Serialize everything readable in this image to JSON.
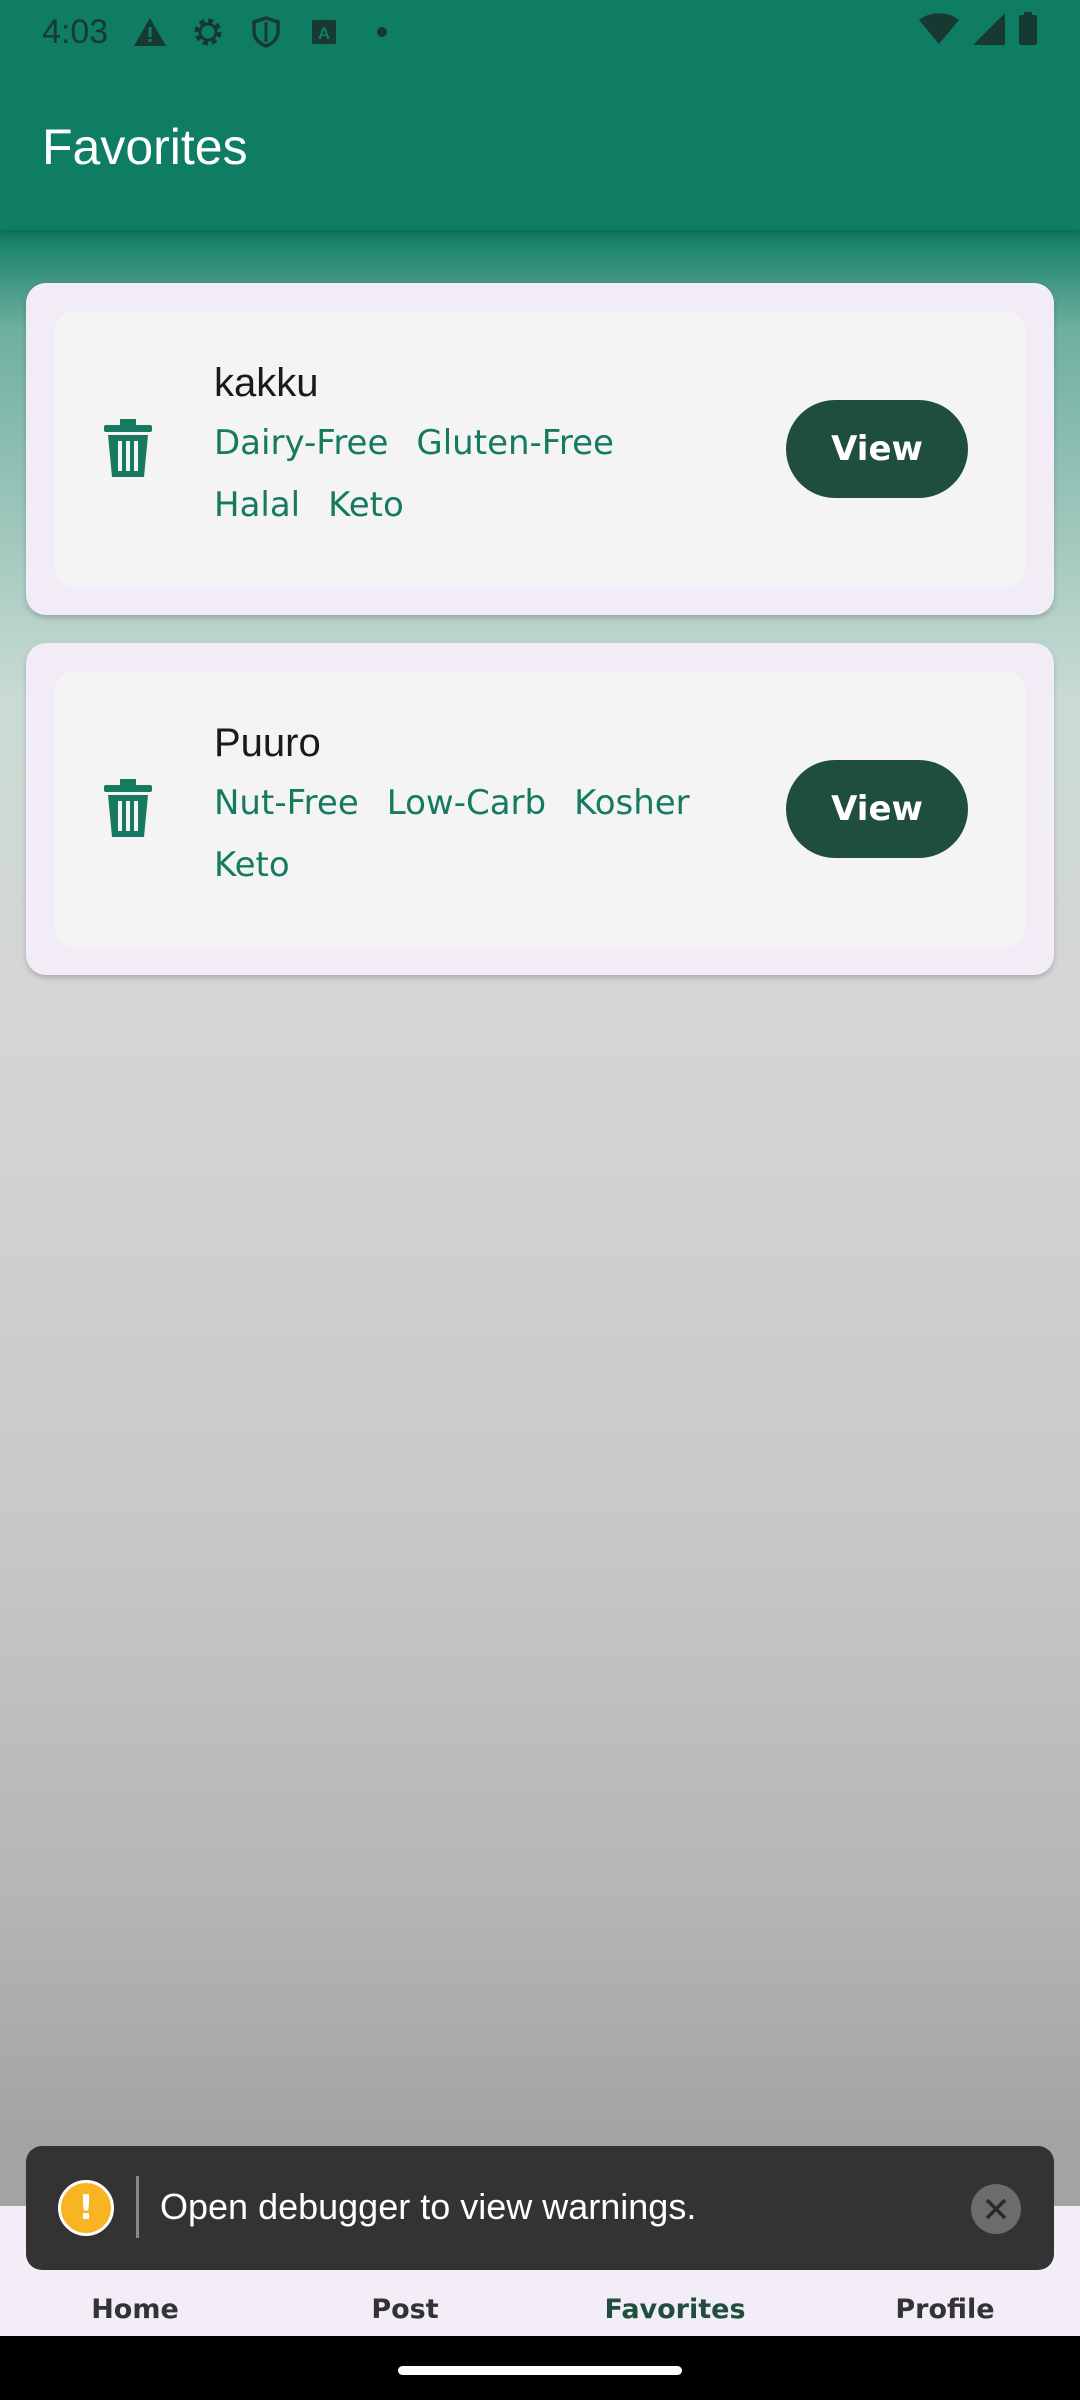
{
  "status_bar": {
    "time": "4:03",
    "icons": [
      "alert-icon",
      "gear-icon",
      "shield-icon",
      "a-icon",
      "dot-icon",
      "wifi-icon",
      "signal-icon",
      "battery-icon"
    ]
  },
  "app_bar": {
    "title": "Favorites"
  },
  "favorites": [
    {
      "name": "kakku",
      "tags": [
        "Dairy-Free",
        "Gluten-Free",
        "Halal",
        "Keto"
      ],
      "view_label": "View"
    },
    {
      "name": "Puuro",
      "tags": [
        "Nut-Free",
        "Low-Carb",
        "Kosher",
        "Keto"
      ],
      "view_label": "View"
    }
  ],
  "toast": {
    "message": "Open debugger to view warnings.",
    "icon_text": "!"
  },
  "bottom_nav": {
    "items": [
      {
        "label": "Home",
        "icon": "home-icon",
        "active": false
      },
      {
        "label": "Post",
        "icon": "plus-icon",
        "active": false
      },
      {
        "label": "Favorites",
        "icon": "bookmark-icon",
        "active": true
      },
      {
        "label": "Profile",
        "icon": "profile-icon",
        "active": false
      }
    ]
  },
  "colors": {
    "primary": "#0f7d63",
    "button": "#1f4f3c",
    "tag": "#157a5f",
    "warning": "#f7b524"
  }
}
